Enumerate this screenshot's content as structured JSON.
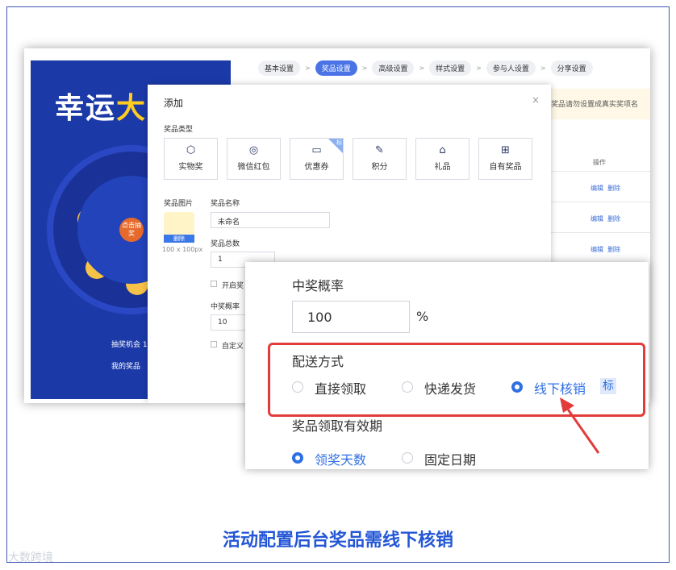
{
  "caption": "活动配置后台奖品需线下核销",
  "watermark": "大数跨境",
  "phone": {
    "title_white": "幸运",
    "title_yellow": "大",
    "spin_label": "点击抽奖",
    "chance_text": "抽奖机会 10 次",
    "my_prize": "我的奖品"
  },
  "steps": [
    "基本设置",
    "奖品设置",
    "高级设置",
    "样式设置",
    "参与人设置",
    "分享设置"
  ],
  "active_step": 1,
  "notice": "非奖品请勿设置成真实奖项名",
  "table": {
    "col_op": "操作",
    "row_actions": [
      "编辑",
      "删除"
    ]
  },
  "modal": {
    "title": "添加",
    "close": "×",
    "type_label": "奖品类型",
    "types": [
      {
        "label": "实物奖",
        "icon": "cube-icon"
      },
      {
        "label": "微信红包",
        "icon": "redpacket-icon"
      },
      {
        "label": "优惠券",
        "icon": "coupon-icon",
        "tag": "标"
      },
      {
        "label": "积分",
        "icon": "points-icon"
      },
      {
        "label": "礼品",
        "icon": "gift-icon"
      },
      {
        "label": "自有奖品",
        "icon": "box-icon"
      }
    ],
    "img_label": "奖品图片",
    "img_delete": "删除",
    "img_size": "100 x 100px",
    "name_label": "奖品名称",
    "name_value": "未命名",
    "total_label": "奖品总数",
    "total_value": "1",
    "open_label": "开启奖",
    "prob_label": "中奖概率",
    "prob_value": "10",
    "custom_label": "自定义"
  },
  "zoom": {
    "prob_label": "中奖概率",
    "prob_value": "100",
    "prob_unit": "%",
    "delivery_label": "配送方式",
    "delivery_options": [
      "直接领取",
      "快递发货",
      "线下核销"
    ],
    "delivery_selected": 2,
    "delivery_tag": "标",
    "validity_label": "奖品领取有效期",
    "validity_options": [
      "领奖天数",
      "固定日期"
    ],
    "validity_selected": 0
  },
  "colors": {
    "accent": "#2f6fe4",
    "highlight_border": "#e23b3b",
    "caption": "#2457d6"
  }
}
